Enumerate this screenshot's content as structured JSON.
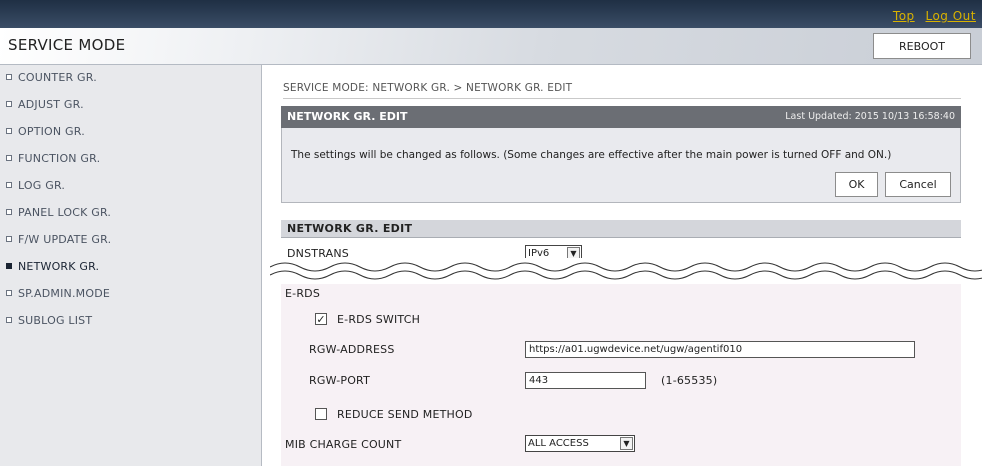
{
  "header": {
    "links": [
      "Top",
      "Log Out"
    ],
    "app_title": "SERVICE MODE",
    "reboot_label": "REBOOT"
  },
  "sidebar": {
    "items": [
      {
        "label": "COUNTER GR.",
        "active": false
      },
      {
        "label": "ADJUST GR.",
        "active": false
      },
      {
        "label": "OPTION GR.",
        "active": false
      },
      {
        "label": "FUNCTION GR.",
        "active": false
      },
      {
        "label": "LOG GR.",
        "active": false
      },
      {
        "label": "PANEL LOCK GR.",
        "active": false
      },
      {
        "label": "F/W UPDATE GR.",
        "active": false
      },
      {
        "label": "NETWORK GR.",
        "active": true
      },
      {
        "label": "SP.ADMIN.MODE",
        "active": false
      },
      {
        "label": "SUBLOG LIST",
        "active": false
      }
    ]
  },
  "main": {
    "breadcrumb": "SERVICE MODE: NETWORK GR. > NETWORK GR. EDIT",
    "edit_panel": {
      "title": "NETWORK GR. EDIT",
      "last_updated": "Last Updated: 2015 10/13 16:58:40",
      "message": "The settings will be changed as follows. (Some changes are effective after the main power is turned OFF and ON.)",
      "ok_label": "OK",
      "cancel_label": "Cancel"
    },
    "settings_section": {
      "title": "NETWORK GR. EDIT",
      "dnstrans": {
        "label": "DNSTRANS",
        "value": "IPv6"
      },
      "erds_label": "E-RDS",
      "erds_switch": {
        "label": "E-RDS SWITCH",
        "checked": true
      },
      "rgw_address": {
        "label": "RGW-ADDRESS",
        "value": "https://a01.ugwdevice.net/ugw/agentif010"
      },
      "rgw_port": {
        "label": "RGW-PORT",
        "value": "443",
        "range_hint": "(1-65535)"
      },
      "reduce_send": {
        "label": "REDUCE SEND METHOD",
        "checked": false
      },
      "mib_charge": {
        "label": "MIB CHARGE COUNT",
        "value": "ALL ACCESS"
      }
    }
  },
  "colors": {
    "topbar": "#1f2f44",
    "link": "#d8b100",
    "panel_header": "#6b6e74",
    "sidebar_bg": "#e8e9ec",
    "lower_bg": "#f7f1f5"
  }
}
